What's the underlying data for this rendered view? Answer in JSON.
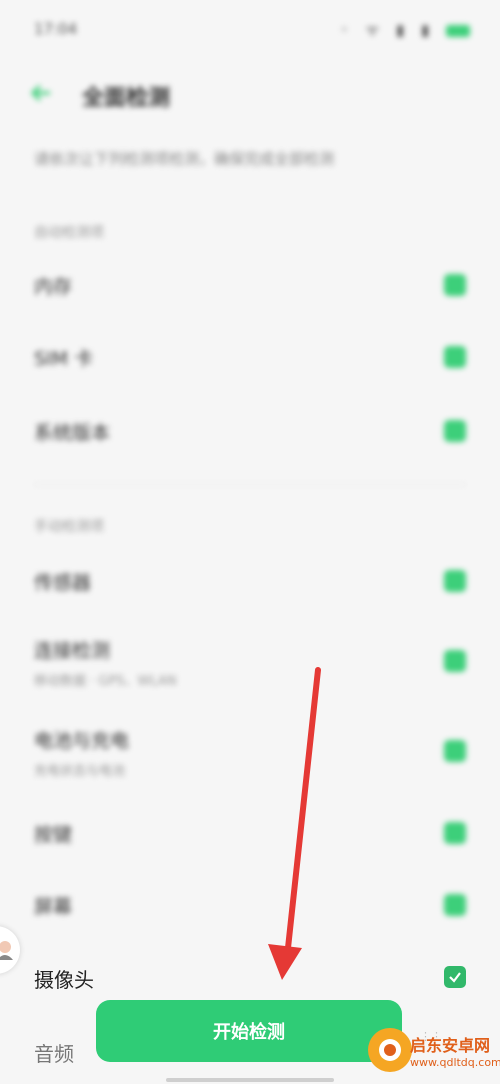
{
  "status_bar": {
    "time": "17:04",
    "icons": "◦ ᯤ ▮ ▮"
  },
  "header": {
    "title": "全面检测"
  },
  "description": "请依次让下列检测项检测，确保完成全部检测",
  "sections": {
    "auto": {
      "label": "自动检测项"
    },
    "manual": {
      "label": "手动检测项"
    }
  },
  "auto_items": [
    {
      "label": "内存"
    },
    {
      "label": "SIM 卡"
    },
    {
      "label": "系统版本"
    }
  ],
  "manual_items": [
    {
      "label": "传感器",
      "sub": ""
    },
    {
      "label": "连接检测",
      "sub": "移动数据 · GPS、WLAN"
    },
    {
      "label": "电池与充电",
      "sub": "充电状态与电池"
    },
    {
      "label": "按键",
      "sub": ""
    },
    {
      "label": "屏幕",
      "sub": ""
    }
  ],
  "camera": {
    "label": "摄像头"
  },
  "audio": {
    "label": "音频"
  },
  "start_button": {
    "label": "开始检测"
  },
  "watermark": {
    "title": "启东安卓网",
    "url": "www.qdltdq.com"
  },
  "colors": {
    "accent": "#2fcc76",
    "arrow": "#e53935"
  }
}
